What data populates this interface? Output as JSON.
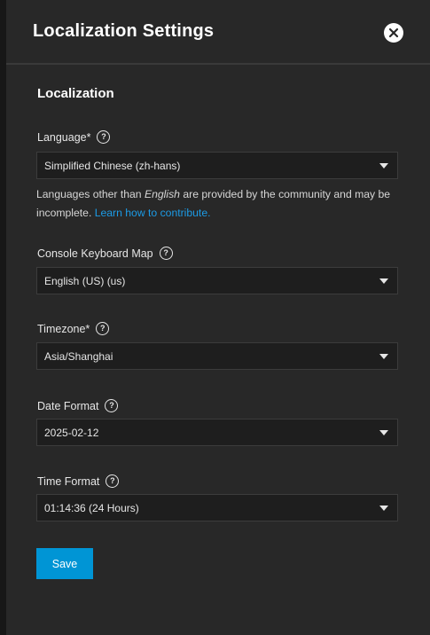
{
  "dialog": {
    "title": "Localization Settings",
    "close_icon": "close-icon"
  },
  "section": {
    "title": "Localization"
  },
  "language": {
    "label": "Language*",
    "value": "Simplified Chinese (zh-hans)",
    "hint_prefix": "Languages other than ",
    "hint_emphasis": "English",
    "hint_suffix": " are provided by the community and may be incomplete. ",
    "hint_link": "Learn how to contribute."
  },
  "keyboard_map": {
    "label": "Console Keyboard Map",
    "value": "English (US) (us)"
  },
  "timezone": {
    "label": "Timezone*",
    "value": "Asia/Shanghai"
  },
  "date_format": {
    "label": "Date Format",
    "value": "2025-02-12"
  },
  "time_format": {
    "label": "Time Format",
    "value": "01:14:36 (24 Hours)"
  },
  "actions": {
    "save_label": "Save"
  },
  "colors": {
    "panel_bg": "#282828",
    "accent": "#0095d5",
    "link": "#1c9be6"
  }
}
